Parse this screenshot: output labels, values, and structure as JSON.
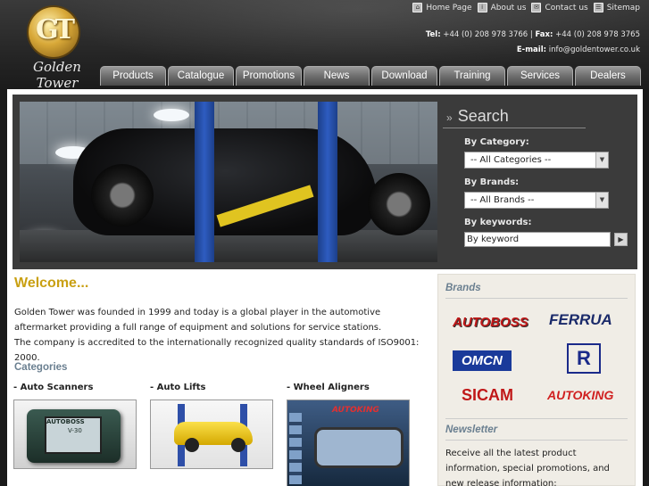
{
  "brand": {
    "logo_letters": "GT",
    "name": "Golden Tower"
  },
  "toplinks": [
    {
      "icon": "home-icon",
      "label": "Home Page"
    },
    {
      "icon": "info-icon",
      "label": "About us"
    },
    {
      "icon": "mail-icon",
      "label": "Contact us"
    },
    {
      "icon": "sitemap-icon",
      "label": "Sitemap"
    }
  ],
  "contact": {
    "tel_label": "Tel:",
    "tel": "+44 (0) 208 978 3766",
    "separator": "|",
    "fax_label": "Fax:",
    "fax": "+44 (0) 208 978 3765",
    "email_label": "E-mail:",
    "email": "info@goldentower.co.uk"
  },
  "nav": [
    "Products",
    "Catalogue",
    "Promotions",
    "News",
    "Download",
    "Training",
    "Services",
    "Dealers"
  ],
  "search": {
    "title": "Search",
    "category_label": "By Category:",
    "category_value": "-- All Categories --",
    "brands_label": "By Brands:",
    "brands_value": "-- All Brands --",
    "keywords_label": "By keywords:",
    "keyword_placeholder": "By keyword"
  },
  "welcome": {
    "title": "Welcome...",
    "para1": "Golden Tower was founded in 1999 and today is a global player in the automotive aftermarket providing a full range of equipment and solutions for service stations.",
    "para2": "The company is accredited to the internationally recognized quality standards of ISO9001: 2000."
  },
  "categories": {
    "heading": "Categories",
    "items": [
      {
        "title": "- Auto Scanners"
      },
      {
        "title": "- Auto Lifts"
      },
      {
        "title": "- Wheel Aligners"
      }
    ],
    "scanner_brand": "AUTOBOSS",
    "scanner_model": "V-30",
    "aligner_brand": "AUTOKING"
  },
  "sidebar": {
    "brands_heading": "Brands",
    "brands": [
      "AUTOBOSS",
      "FERRUA",
      "OMCN",
      "R",
      "SICAM",
      "AUTOKING"
    ],
    "newsletter_heading": "Newsletter",
    "newsletter_text": "Receive all the latest product information, special promotions, and new release information:"
  },
  "colors": {
    "accent_gold": "#c9a012",
    "heading_slate": "#6a7f90",
    "nav_gray": "#6e6e6e"
  }
}
